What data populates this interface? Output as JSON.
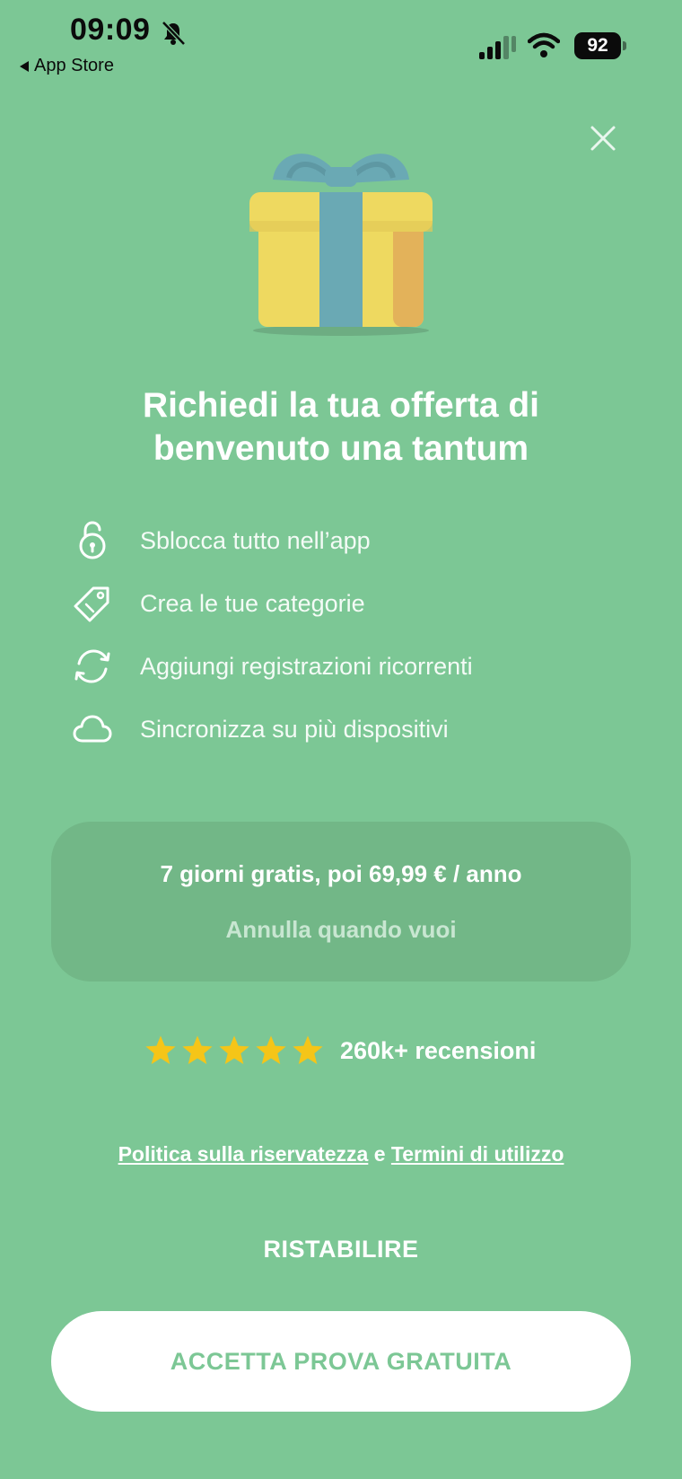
{
  "status_bar": {
    "time": "09:09",
    "back_label": "App Store",
    "battery": "92"
  },
  "title": "Richiedi la tua offerta di benvenuto una tantum",
  "features": [
    {
      "icon": "unlock-icon",
      "label": "Sblocca tutto nell’app"
    },
    {
      "icon": "tag-icon",
      "label": "Crea le tue categorie"
    },
    {
      "icon": "refresh-icon",
      "label": "Aggiungi registrazioni ricorrenti"
    },
    {
      "icon": "cloud-icon",
      "label": "Sincronizza su più dispositivi"
    }
  ],
  "offer": {
    "main": "7 giorni gratis, poi 69,99 € / anno",
    "sub": "Annulla quando vuoi"
  },
  "rating": {
    "stars": 5,
    "text": "260k+ recensioni"
  },
  "legal": {
    "privacy": "Politica sulla riservatezza",
    "joiner": "e",
    "terms": "Termini di utilizzo"
  },
  "restore_label": "RISTABILIRE",
  "cta_label": "ACCETTA PROVA GRATUITA",
  "colors": {
    "background": "#7cc795",
    "box": "#72b787",
    "star": "#f5c518",
    "gift_yellow": "#eed960",
    "gift_ribbon": "#6aa9b4"
  }
}
